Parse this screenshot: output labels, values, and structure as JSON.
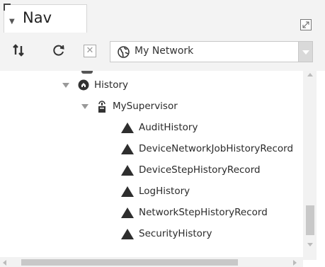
{
  "tab": {
    "label": "Nav"
  },
  "toolbar": {
    "ord_value": "My Network",
    "icons": [
      "sort-toggle-icon",
      "refresh-icon",
      "close-icon",
      "globe-icon",
      "dropdown-caret-icon"
    ]
  },
  "tree": {
    "history": {
      "label": "History"
    },
    "supervisor": {
      "label": "MySupervisor"
    },
    "items": [
      {
        "label": "AuditHistory"
      },
      {
        "label": "DeviceNetworkJobHistoryRecord"
      },
      {
        "label": "DeviceStepHistoryRecord"
      },
      {
        "label": "LogHistory"
      },
      {
        "label": "NetworkStepHistoryRecord"
      },
      {
        "label": "SecurityHistory"
      }
    ]
  },
  "colors": {
    "background": "#f3f3f3",
    "panel": "#ffffff",
    "icon_dark": "#2e2e2e",
    "expander": "#999999",
    "scroll_thumb": "#c8c8c8"
  }
}
